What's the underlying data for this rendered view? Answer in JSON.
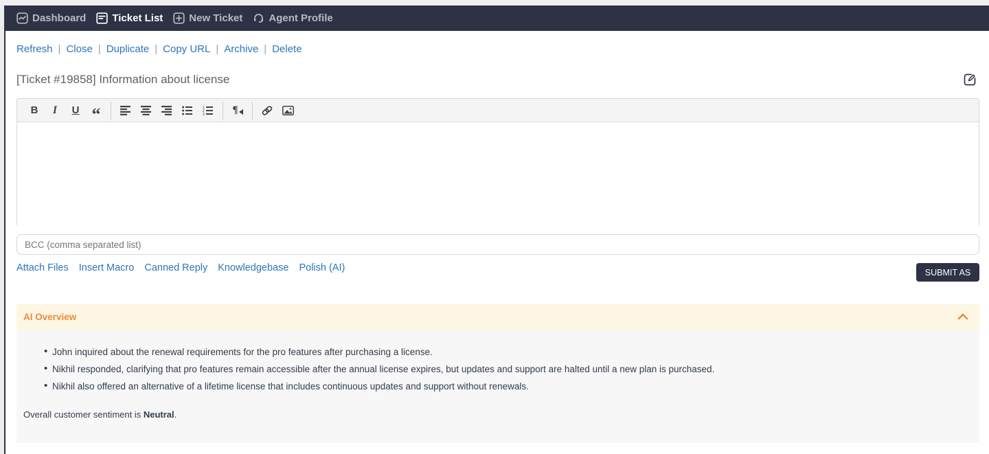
{
  "nav": {
    "items": [
      {
        "label": "Dashboard",
        "icon": "dashboard-icon",
        "active": false
      },
      {
        "label": "Ticket List",
        "icon": "ticket-list-icon",
        "active": true
      },
      {
        "label": "New Ticket",
        "icon": "new-ticket-icon",
        "active": false
      },
      {
        "label": "Agent Profile",
        "icon": "agent-profile-icon",
        "active": false
      }
    ]
  },
  "actions": {
    "items": [
      "Refresh",
      "Close",
      "Duplicate",
      "Copy URL",
      "Archive",
      "Delete"
    ],
    "separator": "|"
  },
  "ticket": {
    "title": "[Ticket #19858] Information about license",
    "edit_icon": "edit-pencil-square-icon"
  },
  "editor": {
    "toolbar": {
      "bold_label": "B",
      "italic_label": "I",
      "underline_label": "U",
      "quote_label": "“",
      "paragraph_label": "¶",
      "icons": [
        "bold-icon",
        "italic-icon",
        "underline-icon",
        "blockquote-icon",
        "align-left-icon",
        "align-center-icon",
        "align-right-icon",
        "bullet-list-icon",
        "numbered-list-icon",
        "paragraph-direction-icon",
        "link-icon",
        "image-icon"
      ]
    },
    "body_value": "",
    "bcc_placeholder": "BCC (comma separated list)"
  },
  "compose_links": [
    "Attach Files",
    "Insert Macro",
    "Canned Reply",
    "Knowledgebase",
    "Polish (AI)"
  ],
  "submit": {
    "label": "SUBMIT AS"
  },
  "ai_overview": {
    "title": "AI Overview",
    "collapse_icon": "chevron-up-icon",
    "bullets": [
      "John inquired about the renewal requirements for the pro features after purchasing a license.",
      "Nikhil responded, clarifying that pro features remain accessible after the annual license expires, but updates and support are halted until a new plan is purchased.",
      "Nikhil also offered an alternative of a lifetime license that includes continuous updates and support without renewals."
    ],
    "sentiment_prefix": "Overall customer sentiment is ",
    "sentiment_value": "Neutral",
    "sentiment_suffix": "."
  },
  "colors": {
    "nav_bg": "#2f3245",
    "accent_blue": "#2c76ba",
    "ai_header_bg": "#fdf6e3",
    "ai_accent_orange": "#ef8a3e",
    "ai_body_bg": "#f7f7f8",
    "submit_bg": "#2f3245"
  }
}
